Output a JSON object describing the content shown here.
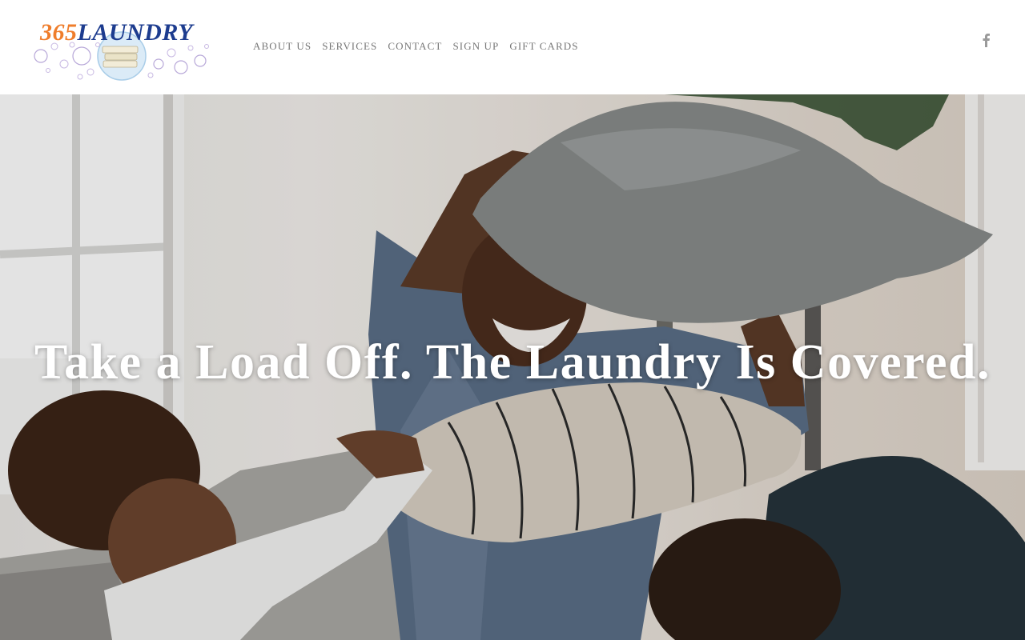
{
  "brand": {
    "logo_number": "365",
    "logo_word": "LAUNDRY"
  },
  "nav": {
    "items": [
      {
        "label": "ABOUT US"
      },
      {
        "label": "SERVICES"
      },
      {
        "label": "CONTACT"
      },
      {
        "label": "SIGN UP"
      },
      {
        "label": "GIFT CARDS"
      }
    ]
  },
  "social": {
    "facebook_icon": "facebook-icon",
    "facebook_glyph": "f"
  },
  "hero": {
    "headline": "Take a Load Off. The Laundry Is Covered."
  },
  "colors": {
    "logo_orange": "#ef7d2b",
    "logo_blue": "#1d3c8f",
    "nav_text": "#777777"
  }
}
